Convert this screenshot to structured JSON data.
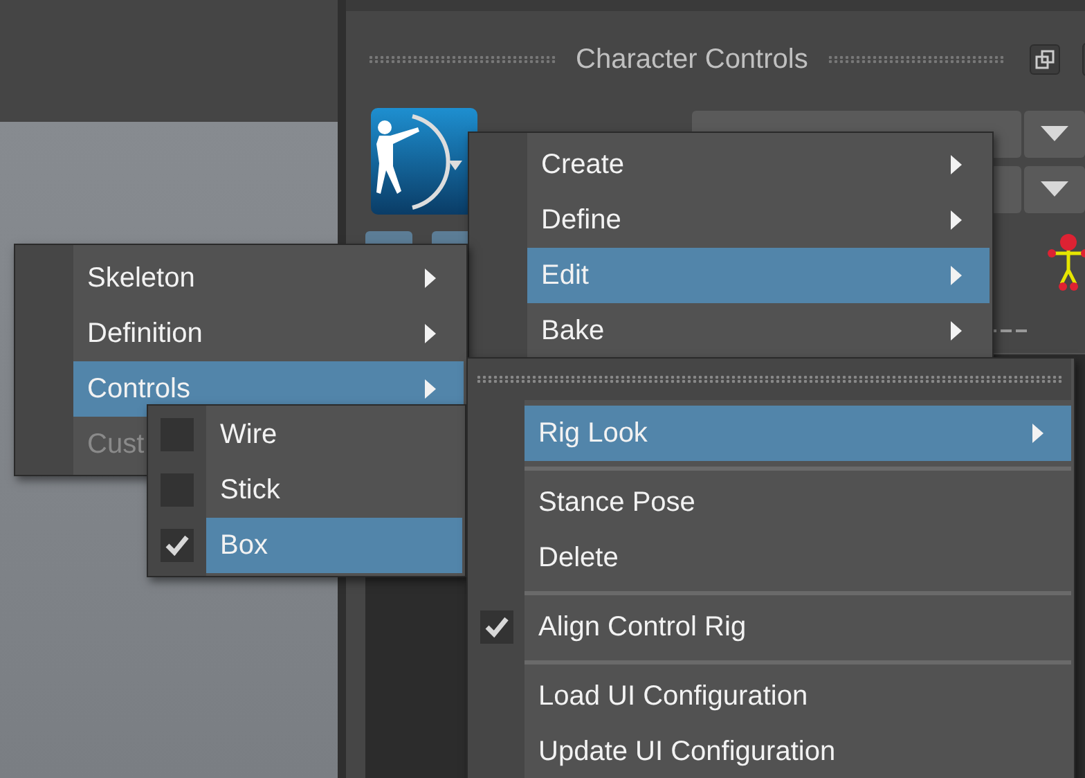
{
  "panel": {
    "title": "Character Controls"
  },
  "menus": [
    {
      "items": [
        {
          "label": "Create",
          "submenu": true,
          "selected": false
        },
        {
          "label": "Define",
          "submenu": true,
          "selected": false
        },
        {
          "label": "Edit",
          "submenu": true,
          "selected": true
        },
        {
          "label": "Bake",
          "submenu": true,
          "selected": false
        }
      ]
    },
    {
      "items": [
        {
          "label": "Skeleton",
          "submenu": true,
          "selected": false,
          "disabled": false
        },
        {
          "label": "Definition",
          "submenu": true,
          "selected": false,
          "disabled": false
        },
        {
          "label": "Controls",
          "submenu": true,
          "selected": true,
          "disabled": false
        },
        {
          "label": "Cust",
          "submenu": false,
          "selected": false,
          "disabled": true
        }
      ]
    },
    {
      "items": [
        {
          "kind": "check",
          "label": "Wire",
          "checked": false,
          "selected": false
        },
        {
          "kind": "check",
          "label": "Stick",
          "checked": false,
          "selected": false
        },
        {
          "kind": "check",
          "label": "Box",
          "checked": true,
          "selected": true
        }
      ]
    },
    {
      "tear_off": true,
      "items": [
        {
          "kind": "item",
          "label": "Rig Look",
          "submenu": true,
          "selected": true
        },
        {
          "kind": "separator"
        },
        {
          "kind": "item",
          "label": "Stance Pose",
          "submenu": false,
          "selected": false
        },
        {
          "kind": "item",
          "label": "Delete",
          "submenu": false,
          "selected": false
        },
        {
          "kind": "separator"
        },
        {
          "kind": "check",
          "label": "Align Control Rig",
          "checked": true,
          "selected": false
        },
        {
          "kind": "separator"
        },
        {
          "kind": "item",
          "label": "Load UI Configuration",
          "submenu": false,
          "selected": false
        },
        {
          "kind": "item",
          "label": "Update UI Configuration",
          "submenu": false,
          "selected": false
        }
      ]
    }
  ]
}
